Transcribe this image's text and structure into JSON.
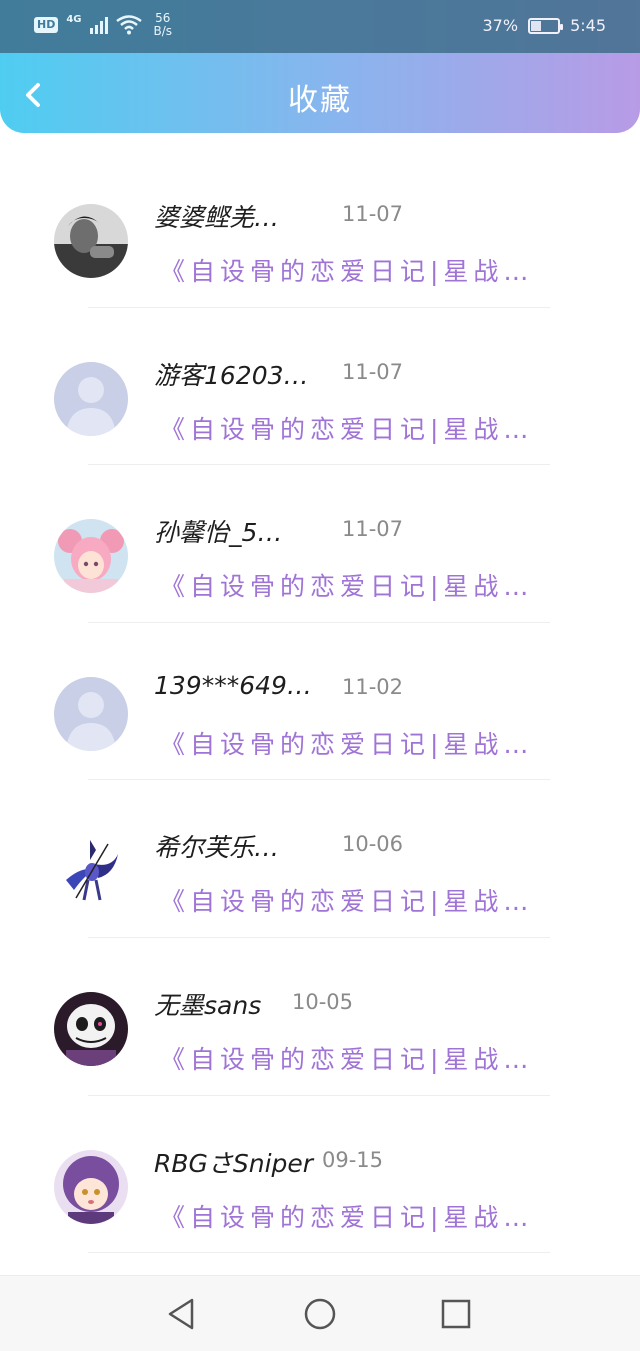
{
  "status_bar": {
    "hd": "HD",
    "network": "4G",
    "speed_value": "56",
    "speed_unit": "B/s",
    "battery_percent": "37%",
    "battery_level": 0.37,
    "time": "5:45"
  },
  "header": {
    "title": "收藏"
  },
  "items": [
    {
      "name": "婆婆鲣羌…",
      "date": "11-07",
      "desc": "《自设骨的恋爱日记|星战…",
      "avatar": "avatar-photo-man-icon"
    },
    {
      "name": "游客16203…",
      "date": "11-07",
      "desc": "《自设骨的恋爱日记|星战…",
      "avatar": "avatar-default-icon"
    },
    {
      "name": "孙馨怡_5…",
      "date": "11-07",
      "desc": "《自设骨的恋爱日记|星战…",
      "avatar": "avatar-anime-pink-girl-icon"
    },
    {
      "name": "139***649…",
      "date": "11-02",
      "desc": "《自设骨的恋爱日记|星战…",
      "avatar": "avatar-default-icon"
    },
    {
      "name": "希尔芙乐…",
      "date": "10-06",
      "desc": "《自设骨的恋爱日记|星战…",
      "avatar": "avatar-anime-character-icon"
    },
    {
      "name": "无墨sans",
      "date": "10-05",
      "desc": "《自设骨的恋爱日记|星战…",
      "avatar": "avatar-sans-skeleton-icon"
    },
    {
      "name": "RBGさSniper",
      "date": "09-15",
      "desc": "《自设骨的恋爱日记|星战…",
      "avatar": "avatar-anime-purple-girl-icon"
    }
  ],
  "nav": {
    "back": "triangle-back-icon",
    "home": "circle-home-icon",
    "recent": "square-recents-icon"
  },
  "colors": {
    "header_gradient_start": "#4fcdf0",
    "header_gradient_end": "#b89be6",
    "desc_text": "#a074d6",
    "date_text": "#8a8a8a"
  }
}
